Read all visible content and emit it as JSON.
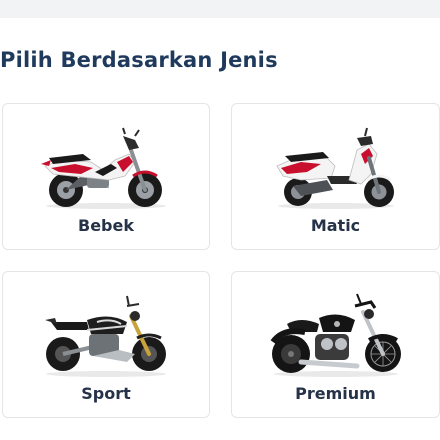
{
  "section": {
    "title": "Pilih Berdasarkan Jenis"
  },
  "categories": [
    {
      "label": "Bebek",
      "icon": "underbone-motorcycle-icon"
    },
    {
      "label": "Matic",
      "icon": "scooter-icon"
    },
    {
      "label": "Sport",
      "icon": "sport-motorcycle-icon"
    },
    {
      "label": "Premium",
      "icon": "cruiser-motorcycle-icon"
    }
  ],
  "colors": {
    "title": "#1f3a5c",
    "card_border": "#e3e5e8",
    "label": "#253247",
    "bebek_accent": "#c8102e",
    "matic_accent": "#c8102e",
    "sport_body": "#1e1e1e",
    "premium_body": "#141414"
  }
}
